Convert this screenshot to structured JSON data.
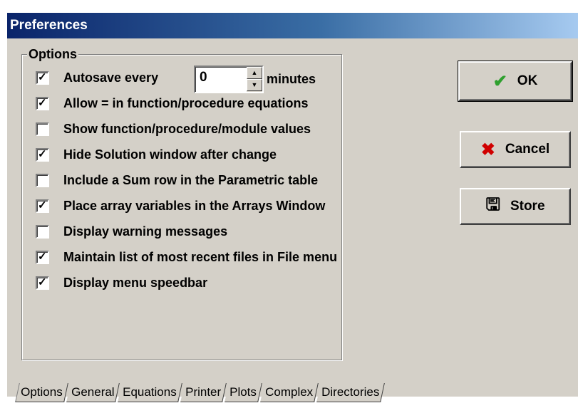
{
  "window": {
    "title": "Preferences"
  },
  "options_group": {
    "label": "Options",
    "autosave": {
      "label": "Autosave every",
      "checked": true,
      "value": "0",
      "unit": "minutes"
    },
    "items": [
      {
        "label": "Allow = in function/procedure equations",
        "checked": true
      },
      {
        "label": "Show function/procedure/module values",
        "checked": false
      },
      {
        "label": "Hide Solution window after change",
        "checked": true
      },
      {
        "label": "Include a Sum row in the Parametric table",
        "checked": false
      },
      {
        "label": "Place array variables in the Arrays Window",
        "checked": true
      },
      {
        "label": "Display warning messages",
        "checked": false
      },
      {
        "label": "Maintain list of most recent files in File menu",
        "checked": true
      },
      {
        "label": "Display menu speedbar",
        "checked": true
      }
    ]
  },
  "buttons": {
    "ok": "OK",
    "cancel": "Cancel",
    "store": "Store"
  },
  "tabs": [
    "Options",
    "General",
    "Equations",
    "Printer",
    "Plots",
    "Complex",
    "Directories"
  ],
  "colors": {
    "title_start": "#0a246a",
    "title_end": "#a6caf0",
    "face": "#d4d0c8"
  }
}
